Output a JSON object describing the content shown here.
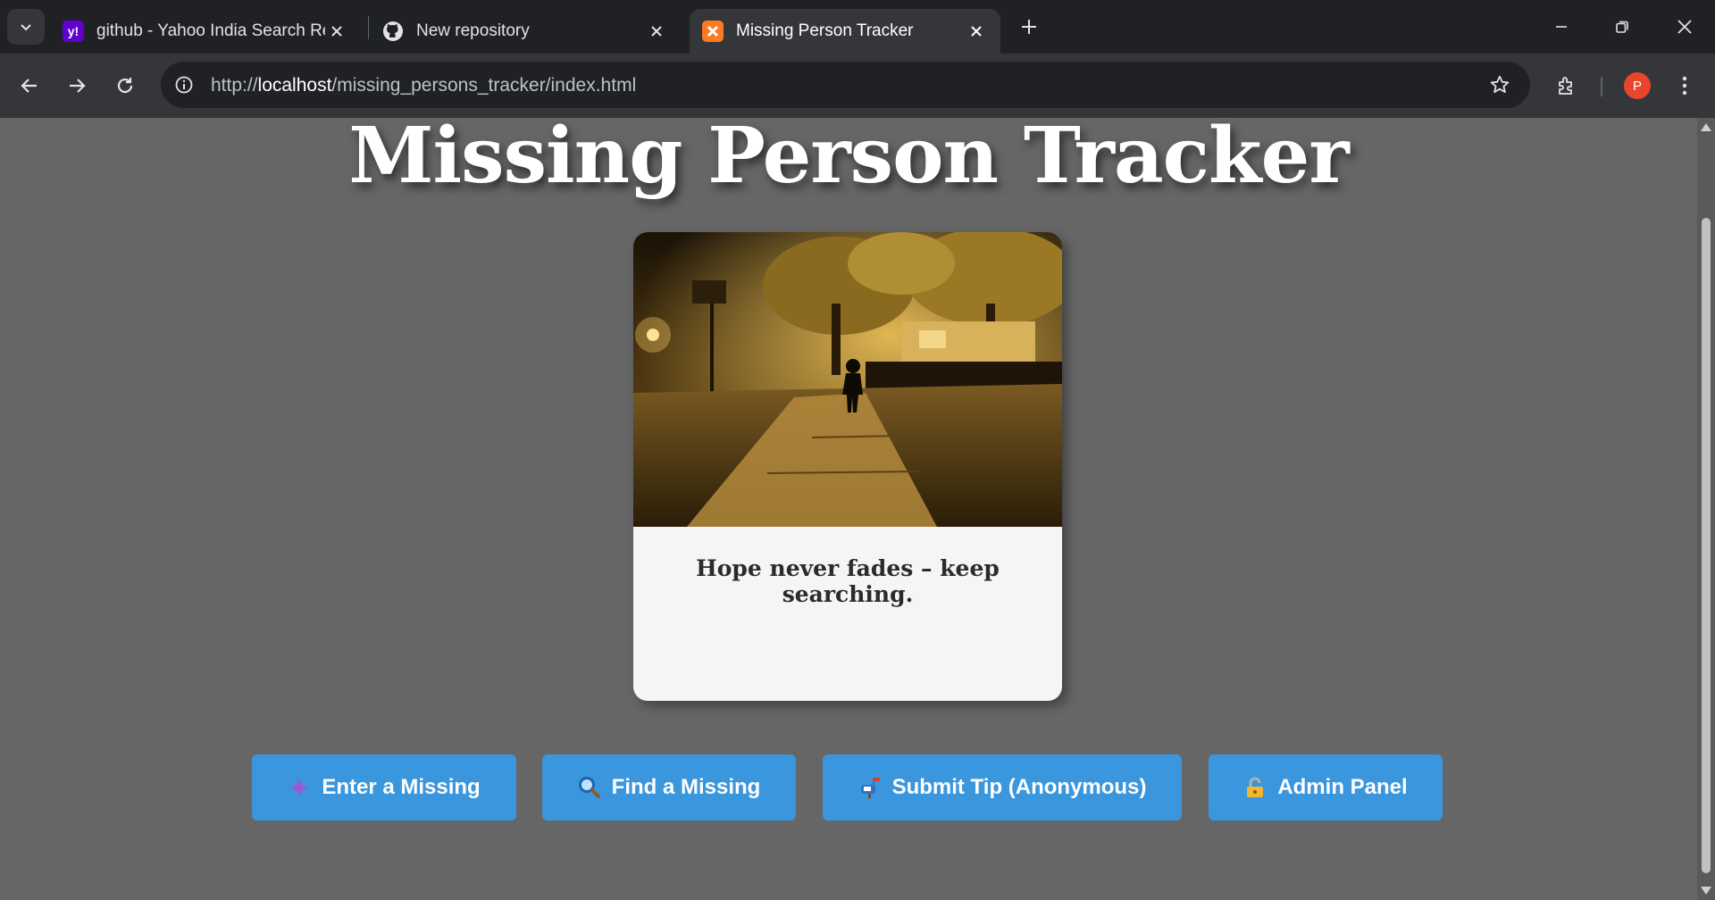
{
  "browser": {
    "tabs": [
      {
        "title": "github - Yahoo India Search Res",
        "favicon": "yahoo-favicon",
        "favicon_text": "y!",
        "active": false
      },
      {
        "title": "New repository",
        "favicon": "github-favicon",
        "active": false
      },
      {
        "title": "Missing Person Tracker",
        "favicon": "xampp-favicon",
        "active": true
      }
    ],
    "url_prefix": "http://",
    "url_host": "localhost",
    "url_path": "/missing_persons_tracker/index.html",
    "profile_initial": "P"
  },
  "page": {
    "title": "Missing Person Tracker",
    "card": {
      "image": "child walking on lamp-lit path at night",
      "caption": "Hope never fades – keep searching."
    },
    "buttons": [
      {
        "label": "Enter a Missing",
        "icon": "sparkle-icon"
      },
      {
        "label": "Find a Missing",
        "icon": "magnifier-icon"
      },
      {
        "label": "Submit Tip (Anonymous)",
        "icon": "mailbox-icon"
      },
      {
        "label": "Admin Panel",
        "icon": "lock-icon"
      }
    ]
  },
  "colors": {
    "page_bg": "#666666",
    "button_bg": "#3a96dd",
    "card_bg": "#f5f5f5"
  }
}
